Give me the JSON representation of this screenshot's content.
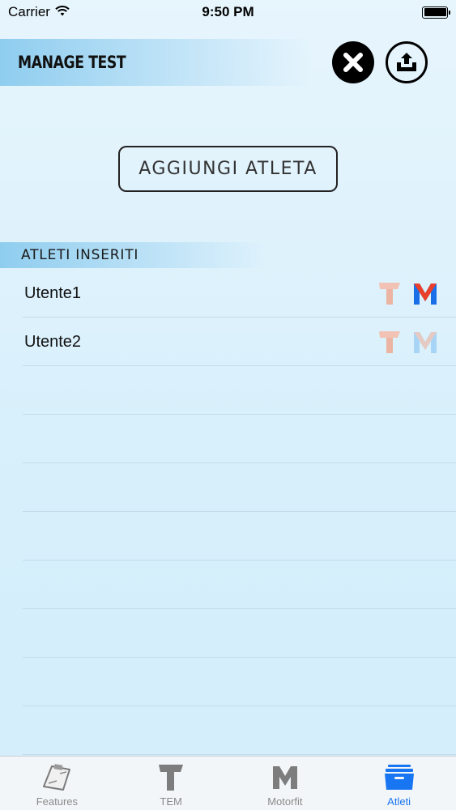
{
  "status_bar": {
    "carrier": "Carrier",
    "time": "9:50 PM"
  },
  "header": {
    "title": "MANAGE TEST"
  },
  "add_athlete_label": "AGGIUNGI ATLETA",
  "section_title": "ATLETI INSERITI",
  "athletes": [
    {
      "name": "Utente1",
      "tem_active": false,
      "motorfit_active": true
    },
    {
      "name": "Utente2",
      "tem_active": false,
      "motorfit_active": false
    }
  ],
  "tabs": [
    {
      "label": "Features",
      "icon": "clipboard-icon",
      "active": false
    },
    {
      "label": "TEM",
      "icon": "t-letter-icon",
      "active": false
    },
    {
      "label": "Motorfit",
      "icon": "m-letter-icon",
      "active": false
    },
    {
      "label": "Atleti",
      "icon": "archive-box-icon",
      "active": true
    }
  ],
  "colors": {
    "accent": "#1976f2",
    "header_gradient": "#8fcdef",
    "background": "#d6effb",
    "tem_icon": "#f0b8a8",
    "motorfit_active_blue": "#1a6fe8",
    "motorfit_active_red": "#e8402a"
  }
}
